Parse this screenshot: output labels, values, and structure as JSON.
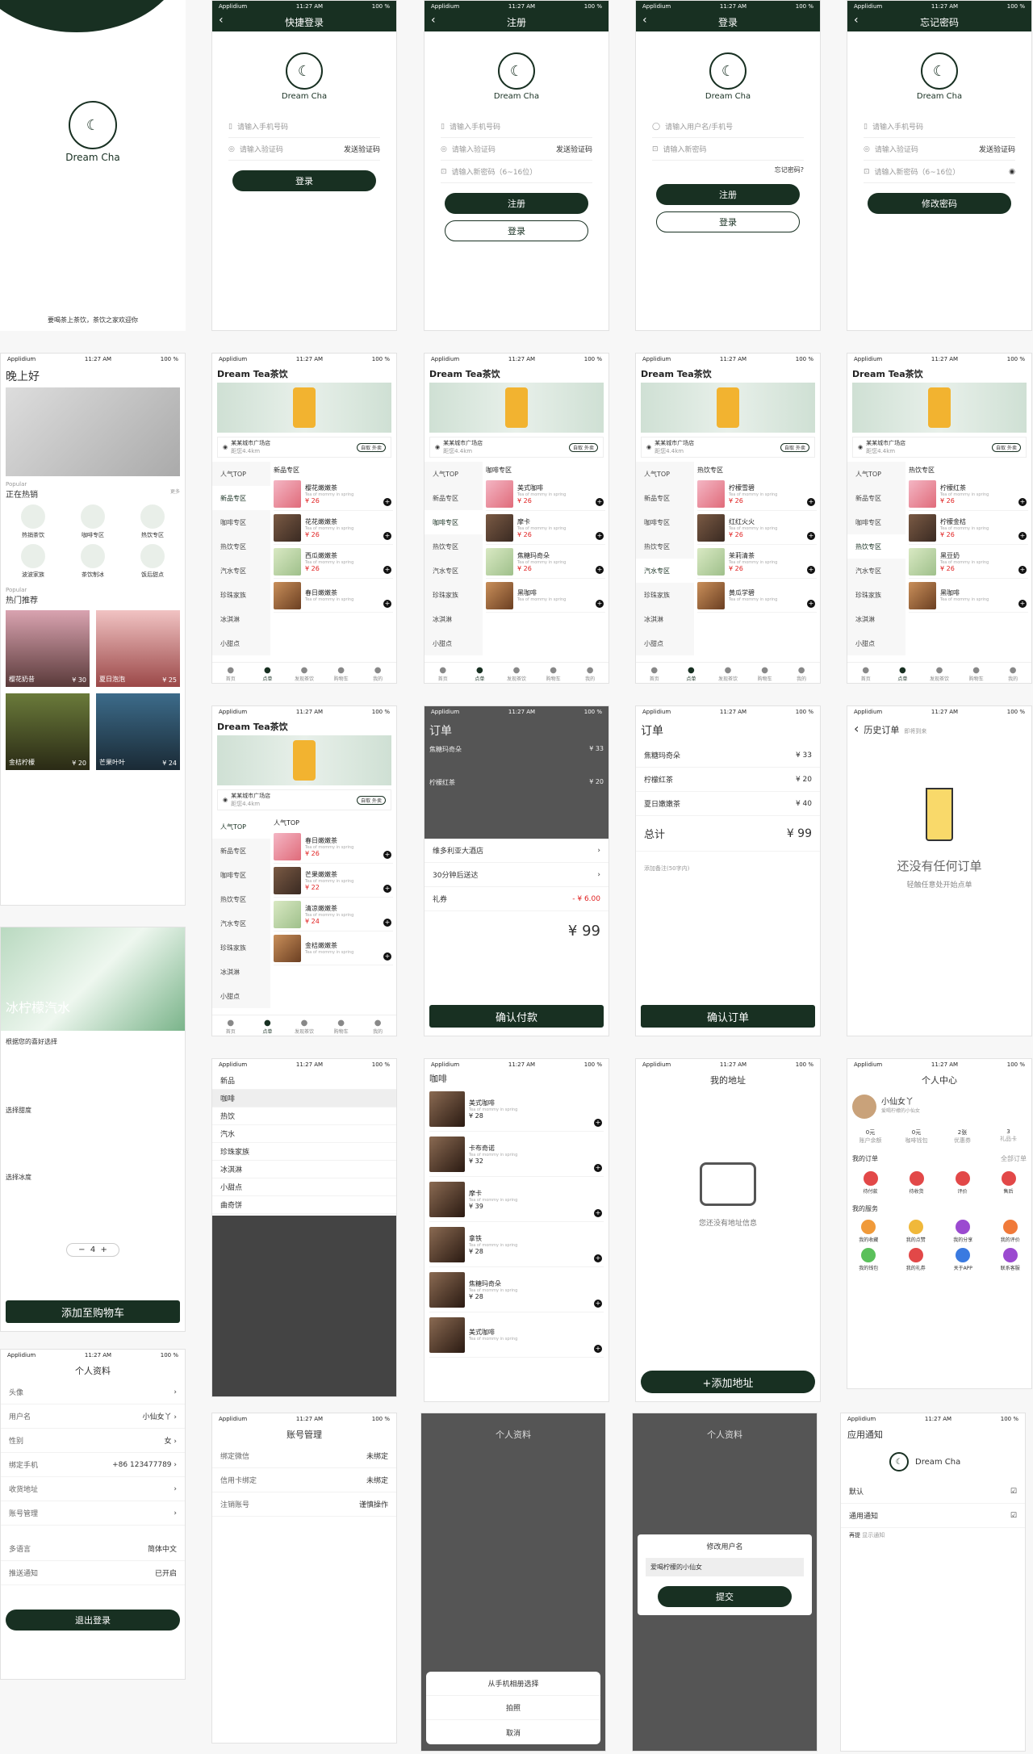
{
  "screens": {
    "splash": {
      "brand": "Dream Cha",
      "slogan": "要喝茶上茶饮，茶饮之家欢迎你"
    },
    "status": {
      "carrier": "Applidium",
      "time": "11:27 AM",
      "battery": "100 %"
    },
    "quick_login": {
      "title": "快捷登录",
      "phone_ph": "请输入手机号码",
      "code_ph": "请输入验证码",
      "send": "发送验证码",
      "login": "登录"
    },
    "register": {
      "title": "注册",
      "phone_ph": "请输入手机号码",
      "code_ph": "请输入验证码",
      "send": "发送验证码",
      "pwd_ph": "请输入新密码（6~16位）",
      "register": "注册",
      "login": "登录"
    },
    "login": {
      "title": "登录",
      "user_ph": "请输入用户名/手机号",
      "pwd_ph": "请输入新密码",
      "forgot": "忘记密码?",
      "register": "注册",
      "login": "登录"
    },
    "forgot": {
      "title": "忘记密码",
      "phone_ph": "请输入手机号码",
      "code_ph": "请输入验证码",
      "send": "发送验证码",
      "pwd_ph": "请输入新密码（6~16位）",
      "submit": "修改密码"
    },
    "home": {
      "greeting": "晚上好",
      "popular1": "Popular",
      "hot_sale": "正在热销",
      "more": "更多",
      "cats": [
        "热销茶饮",
        "咖啡专区",
        "热饮专区",
        "波波家族",
        "茶饮制冰",
        "饭后甜点"
      ],
      "popular2": "Popular",
      "hot_rec": "热门推荐",
      "recs": [
        {
          "name": "樱花奶昔",
          "price": "¥ 30"
        },
        {
          "name": "夏日泡泡",
          "price": "¥ 25"
        },
        {
          "name": "金桔柠檬",
          "price": "¥ 20"
        },
        {
          "name": "芒果叶叶",
          "price": "¥ 24"
        }
      ]
    },
    "shop": {
      "title": "Dream Tea茶饮",
      "addr": "某某城市广场店",
      "dist": "距您4.4km",
      "tag_on": "自取",
      "tag_off": "外卖",
      "cats": [
        "人气TOP",
        "新品专区",
        "咖啡专区",
        "热饮专区",
        "汽水专区",
        "珍珠家族",
        "冰淇淋",
        "小甜点"
      ],
      "lists": [
        {
          "head": "新品专区",
          "items": [
            {
              "n": "樱花嫩嫩茶",
              "p": "¥ 26"
            },
            {
              "n": "花花嫩嫩茶",
              "p": "¥ 26"
            },
            {
              "n": "西瓜嫩嫩茶",
              "p": "¥ 26"
            },
            {
              "n": "春日嫩嫩茶",
              "p": ""
            }
          ]
        },
        {
          "head": "咖啡专区",
          "items": [
            {
              "n": "美式咖啡",
              "p": "¥ 26"
            },
            {
              "n": "摩卡",
              "p": "¥ 26"
            },
            {
              "n": "焦糖玛奇朵",
              "p": "¥ 26"
            },
            {
              "n": "黑咖啡",
              "p": ""
            }
          ]
        },
        {
          "head": "热饮专区",
          "items": [
            {
              "n": "柠檬雪碧",
              "p": "¥ 26"
            },
            {
              "n": "红红火火",
              "p": "¥ 26"
            },
            {
              "n": "茉莉清茶",
              "p": "¥ 26"
            },
            {
              "n": "黄瓜学碧",
              "p": ""
            }
          ]
        },
        {
          "head": "热饮专区",
          "items": [
            {
              "n": "柠檬红茶",
              "p": "¥ 26"
            },
            {
              "n": "柠檬金桔",
              "p": "¥ 26"
            },
            {
              "n": "黑豆奶",
              "p": "¥ 26"
            },
            {
              "n": "黑咖啡",
              "p": ""
            }
          ]
        },
        {
          "head": "人气TOP",
          "items": [
            {
              "n": "春日嫩嫩茶",
              "p": "¥ 26"
            },
            {
              "n": "芒果嫩嫩茶",
              "p": "¥ 22"
            },
            {
              "n": "清凉嫩嫩茶",
              "p": "¥ 24"
            },
            {
              "n": "金桔嫩嫩茶",
              "p": ""
            }
          ]
        }
      ],
      "item_desc": "Tea of mommy in spring"
    },
    "tabs": [
      "首页",
      "点单",
      "发现茶饮",
      "购物车",
      "我的"
    ],
    "order": {
      "title": "订单",
      "items": [
        {
          "n": "焦糖玛奇朵",
          "p": "¥ 33"
        },
        {
          "n": "柠檬红茶",
          "p": "¥ 20"
        },
        {
          "n": "夏日嫩嫩茶",
          "p": "¥ 40"
        }
      ],
      "total": "总计",
      "total_v": "¥ 99",
      "note": "添加备注(50字内)",
      "confirm": "确认订单"
    },
    "pay": {
      "title": "订单",
      "hotel": "维多利亚大酒店",
      "delivery": "30分钟后送达",
      "coupon": "礼券",
      "coupon_v": "- ¥ 6.00",
      "total": "¥ 99",
      "confirm": "确认付款"
    },
    "history": {
      "title": "历史订单",
      "sub": "即将到来",
      "empty": "还没有任何订单",
      "hint": "轻触任意处开始点单"
    },
    "detail": {
      "title": "冰柠檬汽水",
      "opt1": "根据您的喜好选择",
      "opt2": "选择甜度",
      "opt3": "选择冰度",
      "add": "添加至购物车",
      "qty": "4"
    },
    "sort": {
      "items": [
        "新品",
        "咖啡",
        "热饮",
        "汽水",
        "珍珠家族",
        "冰淇淋",
        "小甜点",
        "曲奇饼"
      ]
    },
    "coffee": {
      "title": "咖啡",
      "items": [
        {
          "n": "美式咖啡",
          "p": "¥ 28"
        },
        {
          "n": "卡布奇诺",
          "p": "¥ 32"
        },
        {
          "n": "摩卡",
          "p": "¥ 39"
        },
        {
          "n": "拿铁",
          "p": "¥ 28"
        },
        {
          "n": "焦糖玛奇朵",
          "p": "¥ 28"
        },
        {
          "n": "美式咖啡",
          "p": ""
        }
      ]
    },
    "address": {
      "title": "我的地址",
      "empty": "您还没有地址信息",
      "add": "+添加地址"
    },
    "me": {
      "title": "个人中心",
      "name": "小仙女丫",
      "sub": "爱喝柠檬的小仙女",
      "stats": [
        {
          "v": "0元",
          "l": "账户余额"
        },
        {
          "v": "0元",
          "l": "咖啡钱包"
        },
        {
          "v": "2张",
          "l": "优惠券"
        },
        {
          "v": "3",
          "l": "礼品卡"
        }
      ],
      "orders": "我的订单",
      "all": "全部订单",
      "order_icons": [
        "待付款",
        "待收货",
        "评价",
        "售后"
      ],
      "services": "我的服务",
      "svc": [
        "我的收藏",
        "我的点赞",
        "我的分享",
        "我的评价",
        "我的钱包",
        "我的礼券",
        "关于APP",
        "联系客服"
      ]
    },
    "profile": {
      "title": "个人资料",
      "rows": [
        {
          "k": "头像",
          "v": ""
        },
        {
          "k": "用户名",
          "v": "小仙女丫"
        },
        {
          "k": "性别",
          "v": "女"
        },
        {
          "k": "绑定手机",
          "v": "+86 123477789"
        },
        {
          "k": "收货地址",
          "v": ""
        },
        {
          "k": "账号管理",
          "v": ""
        }
      ],
      "lang_k": "多语言",
      "lang_v": "简体中文",
      "push_k": "推送通知",
      "push_v": "已开启",
      "logout": "退出登录"
    },
    "account": {
      "title": "账号管理",
      "rows": [
        {
          "k": "绑定微信",
          "v": "未绑定"
        },
        {
          "k": "信用卡绑定",
          "v": "未绑定"
        },
        {
          "k": "注销账号",
          "v": "谨慎操作"
        }
      ]
    },
    "photo_sheet": {
      "title": "从手机相册选择",
      "take": "拍照",
      "cancel": "取消"
    },
    "rename": {
      "title": "修改用户名",
      "value": "爱喝柠檬的小仙女",
      "submit": "提交"
    },
    "notify": {
      "title": "应用通知",
      "brand": "Dream Cha",
      "default": "默认",
      "general": "通用通知",
      "chevron_item": "再提",
      "chevron_sub": "显示通知"
    }
  }
}
